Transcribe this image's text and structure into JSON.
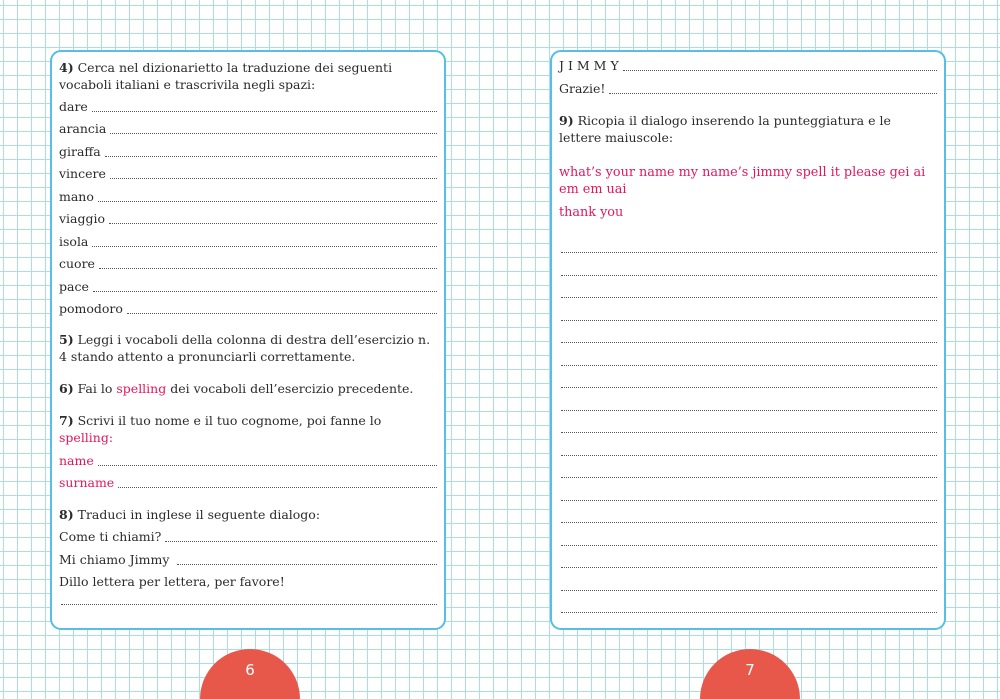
{
  "left": {
    "ex4": {
      "number": "4)",
      "text": "Cerca nel dizionarietto la traduzione dei seguenti vocaboli italiani e trascrivila negli spazi:",
      "words": [
        "dare",
        "arancia",
        "giraffa",
        "vincere",
        "mano",
        "viaggio",
        "isola",
        "cuore",
        "pace",
        "pomodoro"
      ]
    },
    "ex5": {
      "number": "5)",
      "text": "Leggi i vocaboli della colonna di destra dell’esercizio n. 4 stando attento a pronunciarli correttamente."
    },
    "ex6": {
      "number": "6)",
      "text_before": "Fai lo",
      "highlight": "spelling",
      "text_after": "dei vocaboli dell’esercizio precedente."
    },
    "ex7": {
      "number": "7)",
      "text": "Scrivi il tuo nome e il tuo cognome, poi fanne lo",
      "highlight": "spelling:",
      "fields": [
        "name",
        "surname"
      ]
    },
    "ex8": {
      "number": "8)",
      "text": "Traduci in inglese il seguente dialogo:",
      "lines": [
        "Come ti chiami?",
        "Mi chiamo Jimmy",
        "Dillo lettera per lettera, per favore!"
      ]
    },
    "page_number": "6"
  },
  "right": {
    "dialog_lines": [
      "J I M M Y",
      "Grazie!"
    ],
    "ex9": {
      "number": "9)",
      "text": "Ricopia il dialogo inserendo la punteggiatura e le lettere maiuscole:",
      "red_lines": [
        "what’s your name my name’s jimmy spell it please gei ai em em uai",
        "thank you"
      ]
    },
    "page_number": "7"
  },
  "colors": {
    "grid": "#a9dcec",
    "panel_border": "#56bfe3",
    "highlight": "#e2175a",
    "page_badge": "#e8584a"
  }
}
